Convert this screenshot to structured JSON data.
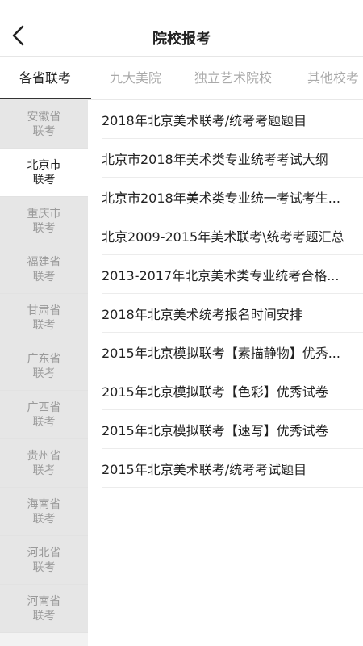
{
  "header": {
    "title": "院校报考",
    "back_icon": "chevron-left-icon"
  },
  "tabs": [
    {
      "label": "各省联考",
      "active": true
    },
    {
      "label": "九大美院",
      "active": false
    },
    {
      "label": "独立艺术院校",
      "active": false
    },
    {
      "label": "其他校考",
      "active": false
    }
  ],
  "sidebar": {
    "items": [
      {
        "line1": "安徽省",
        "line2": "联考",
        "active": false
      },
      {
        "line1": "北京市",
        "line2": "联考",
        "active": true
      },
      {
        "line1": "重庆市",
        "line2": "联考",
        "active": false
      },
      {
        "line1": "福建省",
        "line2": "联考",
        "active": false
      },
      {
        "line1": "甘肃省",
        "line2": "联考",
        "active": false
      },
      {
        "line1": "广东省",
        "line2": "联考",
        "active": false
      },
      {
        "line1": "广西省",
        "line2": "联考",
        "active": false
      },
      {
        "line1": "贵州省",
        "line2": "联考",
        "active": false
      },
      {
        "line1": "海南省",
        "line2": "联考",
        "active": false
      },
      {
        "line1": "河北省",
        "line2": "联考",
        "active": false
      },
      {
        "line1": "河南省",
        "line2": "联考",
        "active": false
      }
    ]
  },
  "list": {
    "items": [
      "2018年北京美术联考/统考考题题目",
      "北京市2018年美术类专业统考考试大纲",
      "北京市2018年美术类专业统一考试考生...",
      "北京2009-2015年美术联考\\统考考题汇总",
      "2013-2017年北京美术类专业统考合格...",
      "2018年北京美术统考报名时间安排",
      "2015年北京模拟联考【素描静物】优秀...",
      "2015年北京模拟联考【色彩】优秀试卷",
      "2015年北京模拟联考【速写】优秀试卷",
      "2015年北京美术联考/统考考试题目"
    ]
  }
}
